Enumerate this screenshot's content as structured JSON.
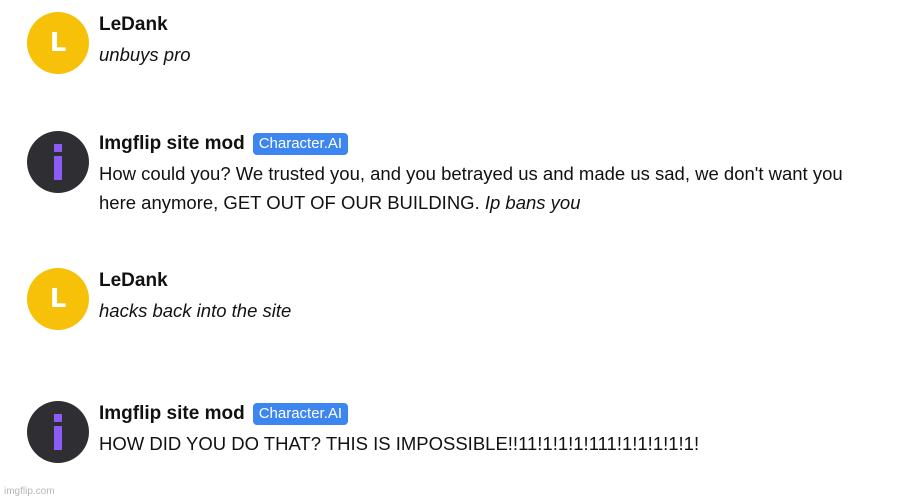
{
  "messages": [
    {
      "author": "LeDank",
      "avatar_letter": "L",
      "text": "unbuys pro"
    },
    {
      "author": "Imgflip site mod",
      "badge": "Character.AI",
      "text": "How could you? We trusted you, and you betrayed us and made us sad, we don't want you here anymore, GET OUT OF OUR BUILDING.",
      "action": "Ip bans you"
    },
    {
      "author": "LeDank",
      "avatar_letter": "L",
      "text": "hacks back into the site"
    },
    {
      "author": "Imgflip site mod",
      "badge": "Character.AI",
      "text": "HOW DID YOU DO THAT? THIS IS IMPOSSIBLE!!11!1!1!1!111!1!1!1!1!1!"
    }
  ],
  "watermark": "imgflip.com",
  "colors": {
    "user_avatar": "#f6c108",
    "bot_avatar": "#2f2f33",
    "bot_glyph": "#8b5cf6",
    "badge": "#3d86f0"
  },
  "icons": {
    "user_avatar": "letter-avatar",
    "bot_avatar": "info-i-icon"
  }
}
